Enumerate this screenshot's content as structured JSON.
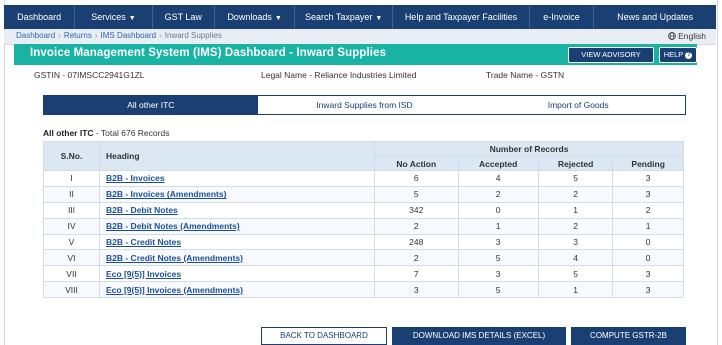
{
  "nav": {
    "items": [
      {
        "label": "Dashboard",
        "caret": false
      },
      {
        "label": "Services",
        "caret": true
      },
      {
        "label": "GST Law",
        "caret": false
      },
      {
        "label": "Downloads",
        "caret": true
      },
      {
        "label": "Search Taxpayer",
        "caret": true
      },
      {
        "label": "Help and Taxpayer Facilities",
        "caret": false
      },
      {
        "label": "e-Invoice",
        "caret": false
      },
      {
        "label": "News and Updates",
        "caret": false
      }
    ],
    "caret_glyph": "▼"
  },
  "breadcrumb": {
    "items": [
      "Dashboard",
      "Returns",
      "IMS Dashboard"
    ],
    "current": "Inward Supplies",
    "separator": "›"
  },
  "language": "English",
  "title": "Invoice Management System (IMS) Dashboard - Inward Supplies",
  "view_advisory_label": "VIEW ADVISORY",
  "help_label": "HELP",
  "taxpayer": {
    "gstin": "GSTIN - 07IMSCC2941G1ZL",
    "legal_name": "Legal Name - Reliance Industries Limited",
    "trade_name": "Trade Name - GSTN"
  },
  "tabs": [
    "All other ITC",
    "Inward Supplies from ISD",
    "Import of Goods"
  ],
  "records_summary": {
    "heading": "All other ITC",
    "text": " - Total 676 Records"
  },
  "table": {
    "col_sno": "S.No.",
    "col_heading": "Heading",
    "group": "Number of Records",
    "sub": {
      "no_action": "No Action",
      "accepted": "Accepted",
      "rejected": "Rejected",
      "pending": "Pending"
    },
    "rows": [
      {
        "sno": "I",
        "heading": "B2B - Invoices",
        "no_action": "6",
        "accepted": "4",
        "rejected": "5",
        "pending": "3"
      },
      {
        "sno": "II",
        "heading": "B2B - Invoices (Amendments)",
        "no_action": "5",
        "accepted": "2",
        "rejected": "2",
        "pending": "3"
      },
      {
        "sno": "III",
        "heading": "B2B - Debit Notes",
        "no_action": "342",
        "accepted": "0",
        "rejected": "1",
        "pending": "2"
      },
      {
        "sno": "IV",
        "heading": "B2B - Debit Notes (Amendments)",
        "no_action": "2",
        "accepted": "1",
        "rejected": "2",
        "pending": "1"
      },
      {
        "sno": "V",
        "heading": "B2B - Credit Notes",
        "no_action": "248",
        "accepted": "3",
        "rejected": "3",
        "pending": "0"
      },
      {
        "sno": "VI",
        "heading": "B2B - Credit Notes (Amendments)",
        "no_action": "2",
        "accepted": "5",
        "rejected": "4",
        "pending": "0"
      },
      {
        "sno": "VII",
        "heading": "Eco [9(5)] Invoices",
        "no_action": "7",
        "accepted": "3",
        "rejected": "5",
        "pending": "3"
      },
      {
        "sno": "VIII",
        "heading": "Eco [9(5)] Invoices (Amendments)",
        "no_action": "3",
        "accepted": "5",
        "rejected": "1",
        "pending": "3"
      }
    ]
  },
  "buttons": {
    "back": "BACK TO DASHBOARD",
    "download": "DOWNLOAD IMS DETAILS (EXCEL)",
    "compute": "COMPUTE GSTR-2B"
  },
  "colors": {
    "nav": "#1a3f72",
    "title_bar": "#19b3a4",
    "accepted": "#1e8a2e",
    "rejected": "#cc2a2a",
    "pending": "#e69a1f"
  },
  "icons": [
    "globe-icon",
    "question-icon",
    "caret-down-icon"
  ]
}
